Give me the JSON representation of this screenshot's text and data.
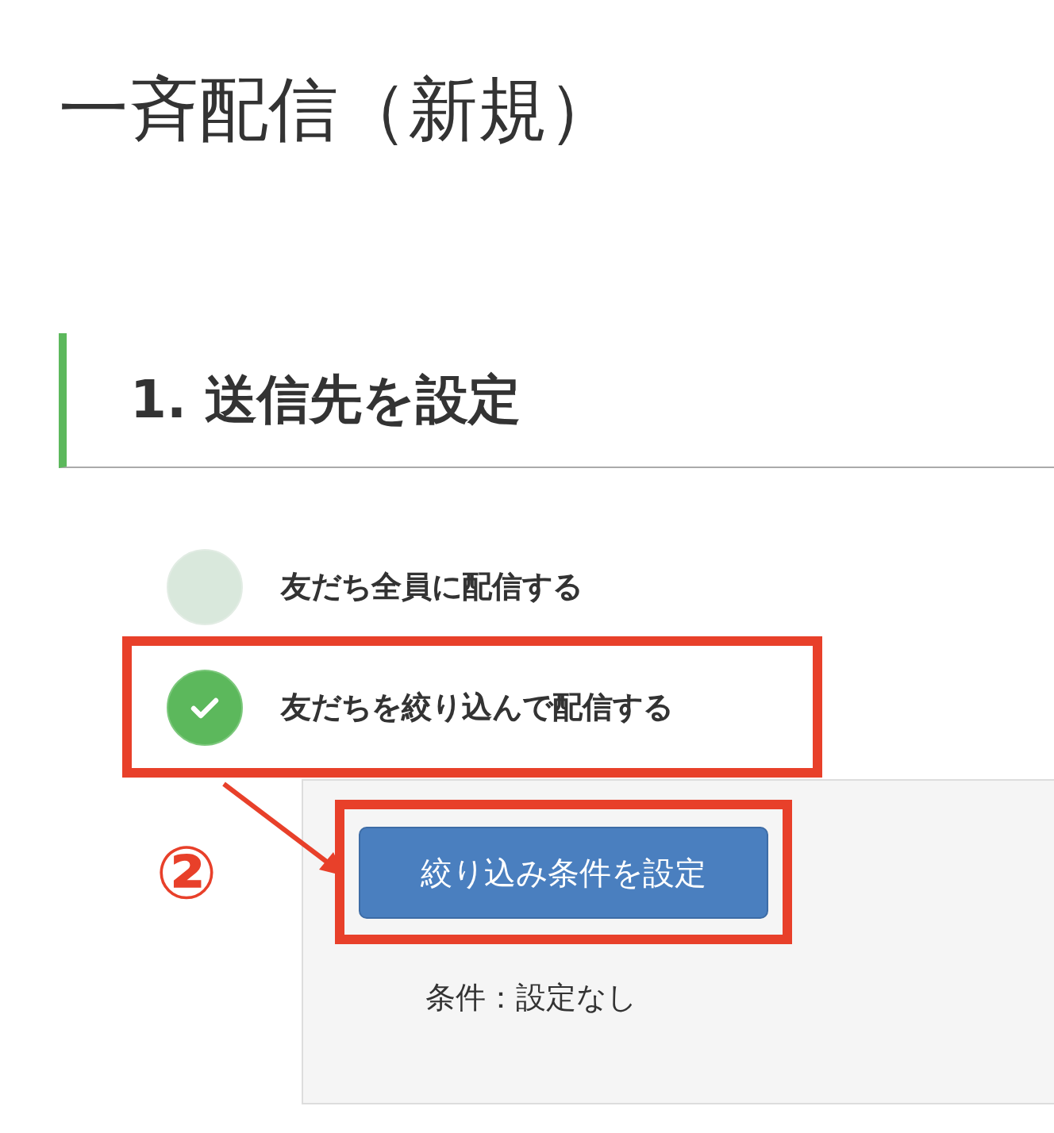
{
  "page_title": "一斉配信（新規）",
  "section": {
    "heading": "1. 送信先を設定"
  },
  "options": [
    {
      "label": "友だち全員に配信する",
      "selected": false,
      "highlighted": false
    },
    {
      "label": "友だちを絞り込んで配信する",
      "selected": true,
      "highlighted": true
    }
  ],
  "filter_panel": {
    "button": {
      "label": "絞り込み条件を設定",
      "highlighted": true
    },
    "condition": "条件：設定なし"
  },
  "annotation": {
    "number": "②"
  }
}
